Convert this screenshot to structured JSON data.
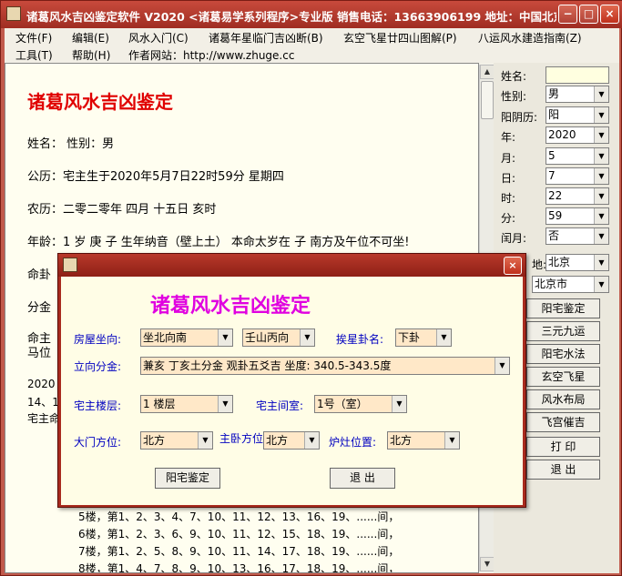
{
  "window": {
    "title": "诸葛风水吉凶鉴定软件 V2020 <诸葛易学系列程序>专业版   销售电话：13663906199   地址：中国北京"
  },
  "titlebar_buttons": {
    "min": "−",
    "max": "□",
    "close": "×"
  },
  "menu": {
    "row1": [
      "文件(F)",
      "编辑(E)",
      "风水入门(C)",
      "诸葛年星临门吉凶断(B)",
      "玄空飞星廿四山图解(P)",
      "八运风水建造指南(Z)"
    ],
    "row2": [
      "工具(T)",
      "帮助(H)",
      "作者网站：http://www.zhuge.cc"
    ]
  },
  "document": {
    "heading": "诸葛风水吉凶鉴定",
    "lines": [
      "姓名：  性别：男",
      "公历：宅主生于2020年5月7日22时59分  星期四",
      "农历：二零二零年  四月  十五日  亥时",
      "年龄：1 岁    庚 子    生年纳音（壁上土）  本命太岁在 子    南方及午位不可坐!",
      "命卦",
      "分金",
      "命主",
      "马位",
      "2020",
      "14、1",
      "宅主命",
      "5楼，第1、2、3、4、7、10、11、12、13、16、19、......间，",
      "6楼，第1、2、3、6、9、10、11、12、15、18、19、......间，",
      "7楼，第1、2、5、8、9、10、11、14、17、18、19、......间，",
      "8楼，第1、4、7、8、9、10、13、16、17、18、19、......间，"
    ]
  },
  "right_panel": {
    "fields": [
      {
        "label": "姓名:",
        "value": ""
      },
      {
        "label": "性别:",
        "value": "男"
      },
      {
        "label": "阳阴历:",
        "value": "阳"
      },
      {
        "label": "年:",
        "value": "2020"
      },
      {
        "label": "月:",
        "value": "5"
      },
      {
        "label": "日:",
        "value": "7"
      },
      {
        "label": "时:",
        "value": "22"
      },
      {
        "label": "分:",
        "value": "59"
      },
      {
        "label": "闰月:",
        "value": "否"
      },
      {
        "label": "地:",
        "value": "北京"
      },
      {
        "label": "",
        "value": "北京市"
      }
    ],
    "buttons": [
      "阳宅鉴定",
      "三元九运",
      "阳宅水法",
      "玄空飞星",
      "风水布局",
      "飞宫催吉",
      "打 印",
      "退 出"
    ]
  },
  "dialog": {
    "heading": "诸葛风水吉凶鉴定",
    "house_direction": {
      "label": "房屋坐向:",
      "value": "坐北向南"
    },
    "mountain": {
      "value": "壬山丙向"
    },
    "gua": {
      "label": "挨星卦名:",
      "value": "下卦"
    },
    "fenjin": {
      "label": "立向分金:",
      "value": "兼亥  丁亥土分金 观卦五爻吉 坐度: 340.5-343.5度"
    },
    "floor": {
      "label": "宅主楼层:",
      "value": "1 楼层"
    },
    "room": {
      "label": "宅主间室:",
      "value": "1号（室）"
    },
    "door": {
      "label": "大门方位:",
      "value": "北方"
    },
    "bedroom": {
      "label": "主卧方位",
      "value": "北方"
    },
    "stove": {
      "label": "炉灶位置:",
      "value": "北方"
    },
    "ok_label": "阳宅鉴定",
    "cancel_label": "退 出",
    "close": "×"
  }
}
